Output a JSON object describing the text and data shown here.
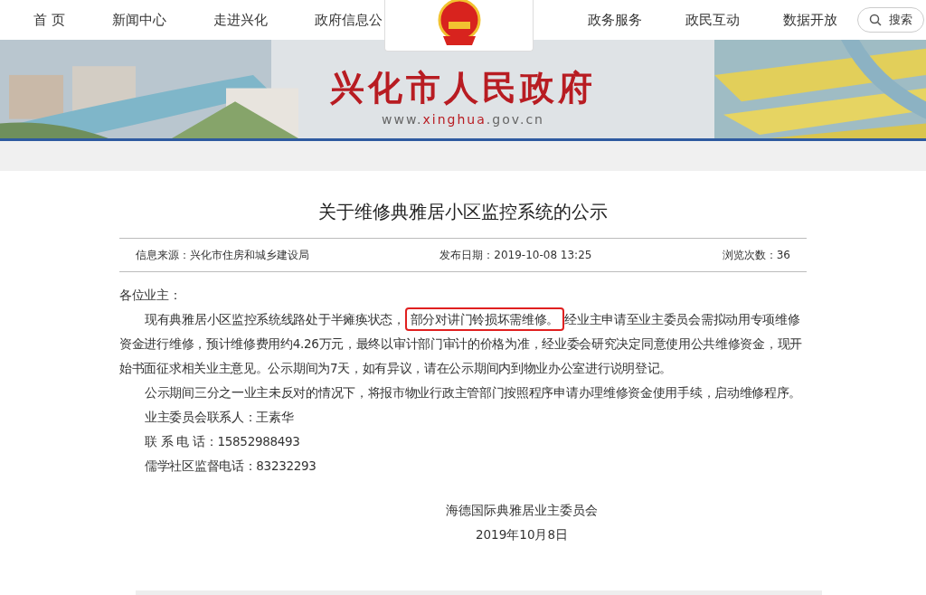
{
  "nav": {
    "left_items": [
      "首 页",
      "新闻中心",
      "走进兴化",
      "政府信息公"
    ],
    "right_items": [
      "政务服务",
      "政民互动",
      "数据开放"
    ],
    "search_button": "搜索"
  },
  "banner": {
    "title": "兴化市人民政府",
    "url_prefix": "www.",
    "url_main": "xinghua",
    "url_suffix": ".gov.cn"
  },
  "article": {
    "title": "关于维修典雅居小区监控系统的公示",
    "meta": [
      "信息来源：兴化市住房和城乡建设局",
      "发布日期：2019-10-08 13:25",
      "浏览次数：36"
    ],
    "greeting": "各位业主：",
    "paragraphs": [
      {
        "before": "现有典雅居小区监控系统线路处于半瘫痪状态，",
        "highlight": "部分对讲门铃损坏需维修。",
        "after": "经业主申请至业主委员会需拟动用专项维修资金进行维修，预计维修费用约4.26万元，最终以审计部门审计的价格为准，经业委会研究决定同意使用公共维修资金，现开始书面征求相关业主意见。公示期间为7天，如有异议，请在公示期间内到物业办公室进行说明登记。"
      },
      {
        "before": "公示期间三分之一业主未反对的情况下，将报市物业行政主管部门按照程序申请办理维修资金使用手续，启动维修程序。"
      }
    ],
    "contacts": [
      "业主委员会联系人：王素华",
      "联 系 电 话：15852988493",
      "儒学社区监督电话：83232293"
    ],
    "signature": "海德国际典雅居业主委员会",
    "date": "2019年10月8日"
  }
}
